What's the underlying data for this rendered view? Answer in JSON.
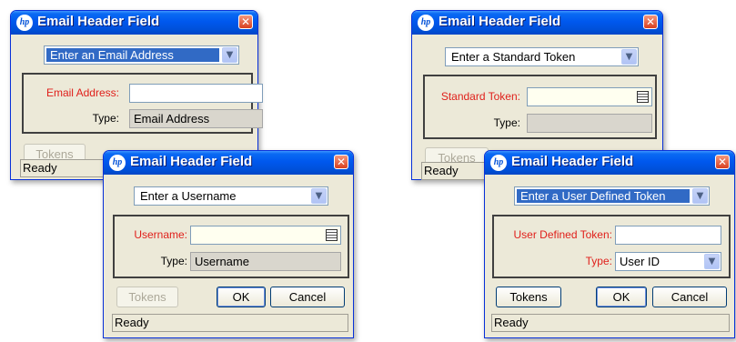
{
  "dialogs": {
    "email": {
      "title": "Email Header Field",
      "mode": "Enter an Email Address",
      "field_label": "Email Address:",
      "field_value": "",
      "type_label": "Type:",
      "type_value": "Email Address",
      "tokens": "Tokens",
      "status": "Ready"
    },
    "username": {
      "title": "Email Header Field",
      "mode": "Enter a Username",
      "field_label": "Username:",
      "field_value": "",
      "type_label": "Type:",
      "type_value": "Username",
      "tokens": "Tokens",
      "ok": "OK",
      "cancel": "Cancel",
      "status": "Ready"
    },
    "standard": {
      "title": "Email Header Field",
      "mode": "Enter a Standard Token",
      "field_label": "Standard Token:",
      "field_value": "",
      "type_label": "Type:",
      "type_value": "",
      "tokens": "Tokens",
      "status": "Ready"
    },
    "user_defined": {
      "title": "Email Header Field",
      "mode": "Enter a User Defined Token",
      "field_label": "User Defined Token:",
      "field_value": "",
      "type_label": "Type:",
      "type_value": "User ID",
      "tokens": "Tokens",
      "ok": "OK",
      "cancel": "Cancel",
      "status": "Ready"
    }
  },
  "colors": {
    "required_label": "#e0201b",
    "titlebar": "#0058ee",
    "dialog_bg": "#ece9d8",
    "selected_bg": "#316ac5"
  },
  "icons": [
    "hp-logo-icon",
    "close-icon",
    "chevron-down-icon",
    "calendar-list-icon"
  ]
}
